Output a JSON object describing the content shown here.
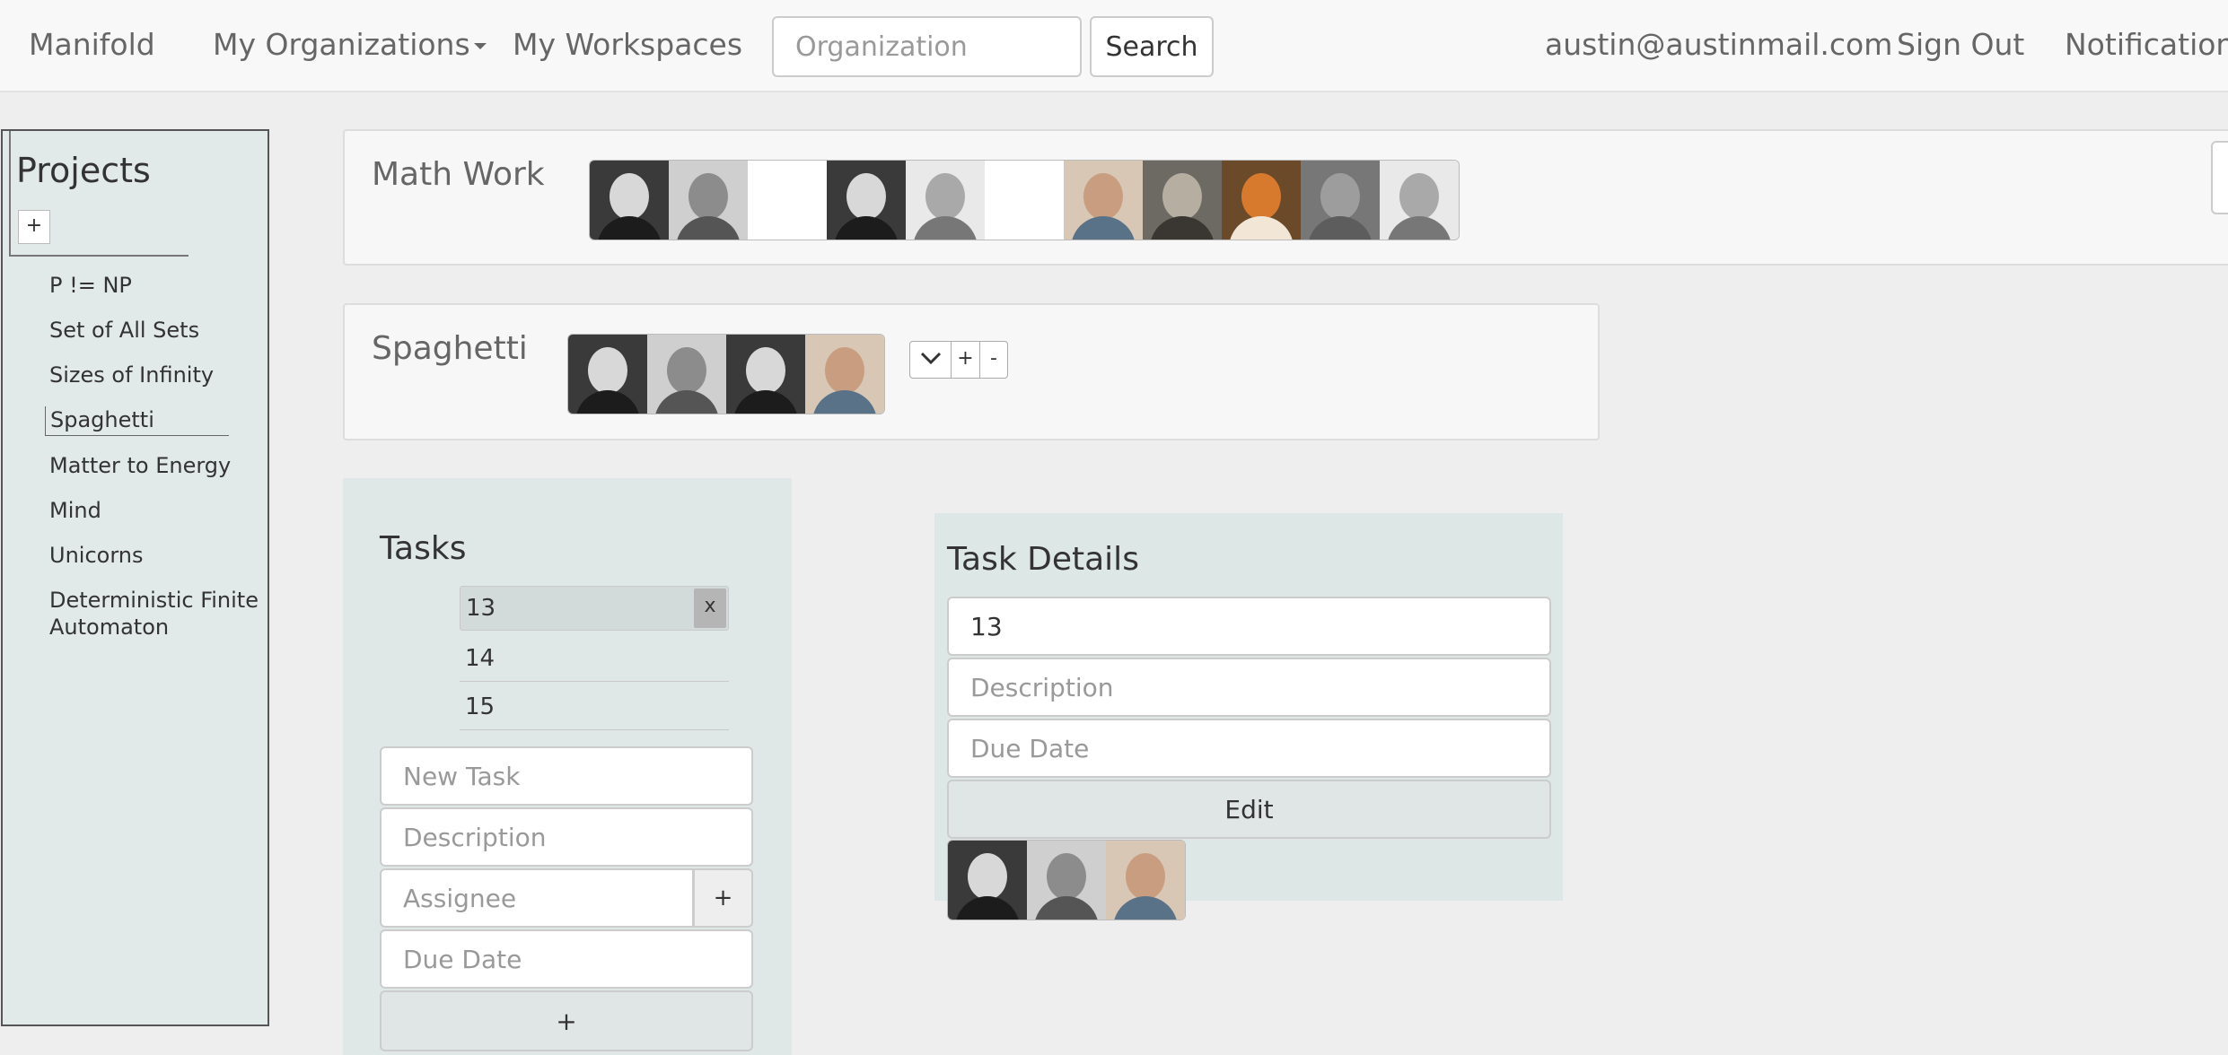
{
  "navbar": {
    "brand": "Manifold",
    "organizations_label": "My Organizations",
    "workspaces_label": "My Workspaces",
    "search_placeholder": "Organization",
    "search_button": "Search",
    "user_email": "austin@austinmail.com",
    "sign_out": "Sign Out",
    "notifications": "Notifications"
  },
  "sidebar": {
    "title": "Projects",
    "add_label": "+",
    "items": [
      {
        "label": "P != NP"
      },
      {
        "label": "Set of All Sets"
      },
      {
        "label": "Sizes of Infinity"
      },
      {
        "label": "Spaghetti",
        "active": true
      },
      {
        "label": "Matter to Energy"
      },
      {
        "label": "Mind"
      },
      {
        "label": "Unicorns"
      },
      {
        "label": "Deterministic Finite Automaton"
      }
    ]
  },
  "projects": [
    {
      "title": "Math Work"
    },
    {
      "title": "Spaghetti",
      "controls": [
        "chevron-down-icon",
        "+",
        "-"
      ]
    }
  ],
  "tasks": {
    "title": "Tasks",
    "items": [
      "13",
      "14",
      "15"
    ],
    "selected": "13",
    "remove_label": "x",
    "new_task_placeholder": "New Task",
    "description_placeholder": "Description",
    "assignee_placeholder": "Assignee",
    "assignee_add_label": "+",
    "due_date_placeholder": "Due Date",
    "submit_label": "+"
  },
  "task_details": {
    "title": "Task Details",
    "name_value": "13",
    "description_placeholder": "Description",
    "due_date_placeholder": "Due Date",
    "edit_label": "Edit"
  }
}
